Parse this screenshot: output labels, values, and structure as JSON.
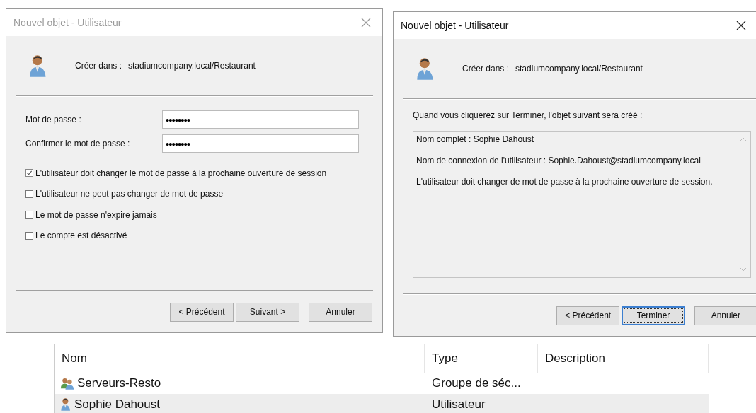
{
  "dialogs": [
    {
      "kind": "password",
      "title": "Nouvel objet - Utilisateur",
      "active": false,
      "create_in_label": "Créer dans :",
      "create_in_value": "stadiumcompany.local/Restaurant",
      "fields": [
        {
          "label": "Mot de passe :",
          "value": "••••••••"
        },
        {
          "label": "Confirmer le mot de passe :",
          "value": "••••••••"
        }
      ],
      "options": [
        {
          "label": "L'utilisateur doit changer le mot de passe à la prochaine ouverture de session",
          "checked": true
        },
        {
          "label": "L'utilisateur ne peut pas changer de mot de passe",
          "checked": false
        },
        {
          "label": "Le mot de passe n'expire jamais",
          "checked": false
        },
        {
          "label": "Le compte est désactivé",
          "checked": false
        }
      ],
      "buttons": [
        {
          "label": "< Précédent",
          "default": false
        },
        {
          "label": "Suivant >",
          "default": false
        },
        {
          "label": "Annuler",
          "default": false
        }
      ]
    },
    {
      "kind": "summary",
      "title": "Nouvel objet - Utilisateur",
      "active": true,
      "create_in_label": "Créer dans :",
      "create_in_value": "stadiumcompany.local/Restaurant",
      "intro": "Quand vous cliquerez sur Terminer, l'objet suivant sera créé :",
      "summary_lines": [
        "Nom complet : Sophie Dahoust",
        "Nom de connexion de l'utilisateur : Sophie.Dahoust@stadiumcompany.local",
        "L'utilisateur doit changer de mot de passe à la prochaine ouverture de session."
      ],
      "buttons": [
        {
          "label": "< Précédent",
          "default": false
        },
        {
          "label": "Terminer",
          "default": true
        },
        {
          "label": "Annuler",
          "default": false
        }
      ]
    }
  ],
  "list": {
    "columns": [
      "Nom",
      "Type",
      "Description"
    ],
    "rows": [
      {
        "kind": "group",
        "name": "Serveurs-Resto",
        "type": "Groupe de séc...",
        "selected": false
      },
      {
        "kind": "user",
        "name": "Sophie Dahoust",
        "type": "Utilisateur",
        "selected": true
      }
    ]
  }
}
